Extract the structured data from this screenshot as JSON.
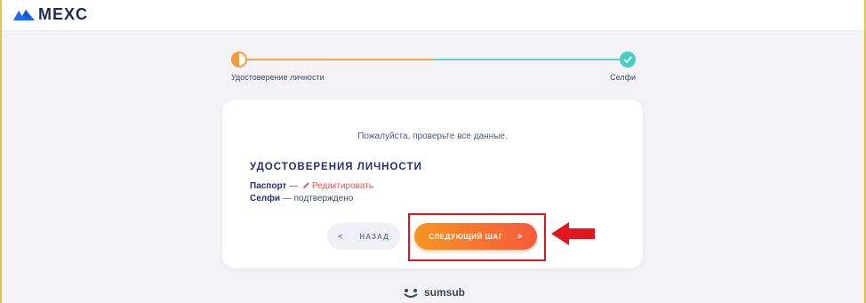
{
  "header": {
    "logo_text": "MEXC",
    "logo_icon": "mexc-mountain-icon",
    "brand_color": "#1d6bf3"
  },
  "stepper": {
    "steps": [
      {
        "label": "Удостоверение личности",
        "state": "in-progress"
      },
      {
        "label": "Селфи",
        "state": "completed"
      }
    ],
    "colors": {
      "progress": "#f39c3c",
      "complete": "#44cfc2"
    }
  },
  "card": {
    "hint": "Пожалуйста, проверьте все данные.",
    "heading": "УДОСТОВЕРЕНИЯ ЛИЧНОСТИ",
    "rows": [
      {
        "label": "Паспорт",
        "separator": " — ",
        "action": "Редактировать",
        "action_icon": "pencil-icon"
      },
      {
        "label": "Селфи",
        "separator": " — ",
        "value": "подтверждено"
      }
    ],
    "buttons": {
      "back_label": "НАЗАД",
      "back_chevron": "<",
      "next_label": "СЛЕДУЮЩИЙ ШАГ",
      "next_chevron": ">"
    }
  },
  "footer": {
    "brand": "sumsub",
    "brand_icon": "sumsub-logo-icon"
  },
  "annotation": {
    "highlight_color": "#e3161f",
    "arrow_icon": "left-arrow-icon"
  }
}
